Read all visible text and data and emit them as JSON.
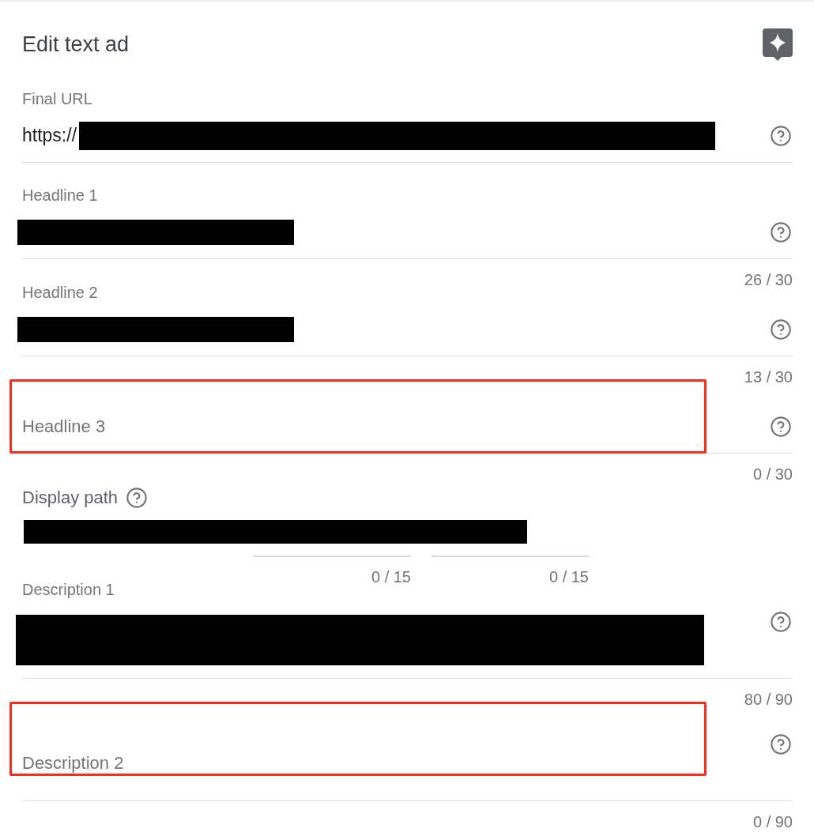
{
  "header": {
    "title": "Edit text ad"
  },
  "fields": [
    {
      "kind": "single",
      "label": "Final URL",
      "empty": false,
      "highlighted": false,
      "value": "https://",
      "redacted": true
    },
    {
      "kind": "single",
      "label": "Headline 1",
      "empty": false,
      "highlighted": false,
      "redacted": true,
      "counter": "26 / 30"
    },
    {
      "kind": "single",
      "label": "Headline 2",
      "empty": false,
      "highlighted": false,
      "redacted": true,
      "counter": "13 / 30"
    },
    {
      "kind": "single",
      "label": "Headline 3",
      "empty": true,
      "highlighted": true,
      "counter": "0 / 30"
    },
    {
      "kind": "path",
      "label": "Display path",
      "redacted": true,
      "paths": [
        {
          "counter": "0 / 15"
        },
        {
          "counter": "0 / 15"
        }
      ]
    },
    {
      "kind": "multi",
      "label": "Description 1",
      "empty": false,
      "highlighted": false,
      "redacted": true,
      "counter": "80 / 90"
    },
    {
      "kind": "multi",
      "label": "Description 2",
      "empty": true,
      "highlighted": true,
      "counter": "0 / 90"
    }
  ]
}
